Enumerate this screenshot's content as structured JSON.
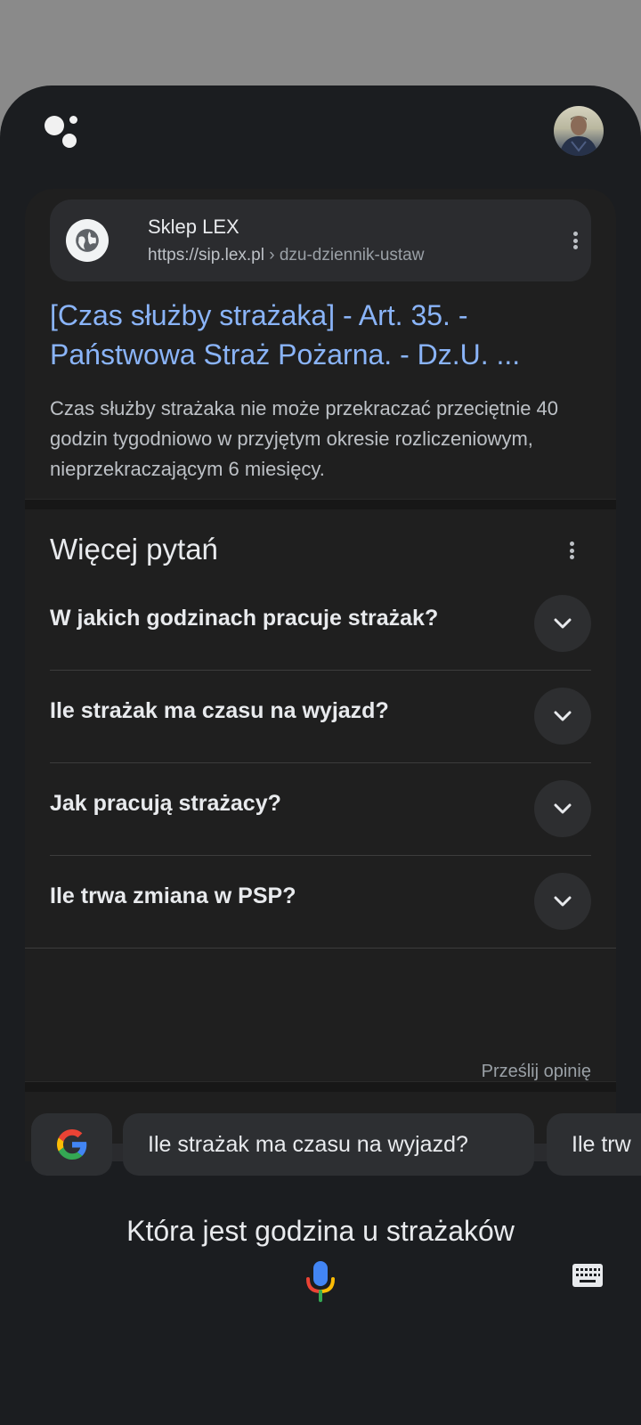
{
  "result": {
    "site_name": "Sklep LEX",
    "url_domain": "https://sip.lex.pl",
    "url_path": "› dzu-dziennik-ustaw",
    "title": "[Czas służby strażaka] - Art. 35. - Państwowa Straż Pożarna. - Dz.U. ...",
    "snippet": "Czas służby strażaka nie może przekraczać przeciętnie 40 godzin tygodniowo w przyjętym okresie rozliczeniowym, nieprzekraczającym 6 miesięcy."
  },
  "people_also_ask": {
    "title": "Więcej pytań",
    "questions": [
      "W jakich godzinach pracuje strażak?",
      "Ile strażak ma czasu na wyjazd?",
      "Jak pracują strażacy?",
      "Ile trwa zmiana w PSP?"
    ],
    "feedback": "Prześlij opinię"
  },
  "suggestions": [
    "Ile strażak ma czasu na wyjazd?",
    "Ile trw"
  ],
  "query": "Która jest godzina u strażaków",
  "icons": {
    "assistant": "google-assistant-icon",
    "globe": "globe-icon",
    "more": "more-vert-icon",
    "expand": "chevron-down-icon",
    "google": "google-g-icon",
    "mic": "microphone-icon",
    "keyboard": "keyboard-icon"
  },
  "colors": {
    "link": "#8ab4f8",
    "sheet_background": "#1b1d20",
    "card_background": "#1f1f1f",
    "scrim": "#8a8a8a"
  }
}
